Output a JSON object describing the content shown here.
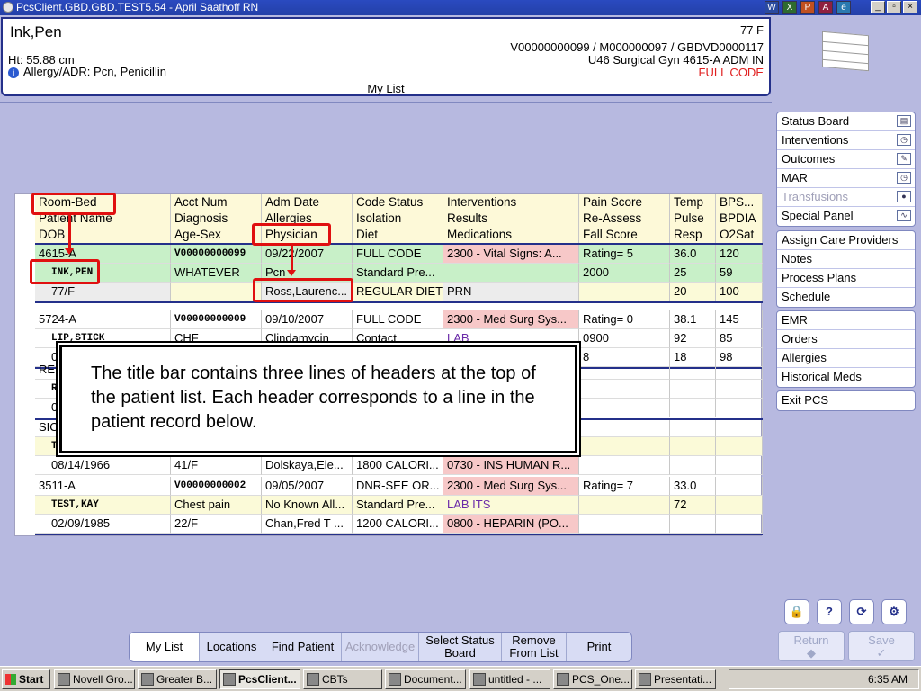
{
  "window": {
    "title": "PcsClient.GBD.GBD.TEST5.54 - April Saathoff RN",
    "toolbar_icons": [
      "W",
      "X",
      "P",
      "A",
      "e"
    ],
    "controls": [
      "_",
      "▫",
      "×"
    ]
  },
  "patient_header": {
    "name": "Ink,Pen",
    "age_sex": "77 F",
    "height": "Ht: 55.88 cm",
    "allergy": "Allergy/ADR: Pcn, Penicillin",
    "ids": "V00000000099 / M000000097 / GBDVD0000117",
    "location": "U46 Surgical Gyn  4615-A  ADM IN",
    "code_status": "FULL CODE",
    "list_name": "My List"
  },
  "grid": {
    "headers": [
      [
        "Room-Bed",
        "Acct Num",
        "Adm Date",
        "Code Status",
        "Interventions",
        "Pain Score",
        "Temp",
        "BPS..."
      ],
      [
        "Patient Name",
        "Diagnosis",
        "Allergies",
        "Isolation",
        "Results",
        "Re-Assess",
        "Pulse",
        "BPDIA"
      ],
      [
        "DOB",
        "Age-Sex",
        "Physician",
        "Diet",
        "Medications",
        "Fall Score",
        "Resp",
        "O2Sat"
      ]
    ],
    "patients": [
      {
        "rows": [
          [
            "4615-A",
            "V00000000099",
            "09/22/2007",
            "FULL CODE",
            "2300 - Vital Signs: A...",
            "Rating= 5",
            "36.0",
            "120"
          ],
          [
            "INK,PEN",
            "WHATEVER",
            "Pcn",
            "Standard Pre...",
            "",
            "2000",
            "25",
            "59"
          ],
          [
            "77/F",
            "",
            "Ross,Laurenc...",
            "REGULAR DIET",
            "PRN",
            "",
            "20",
            "100"
          ]
        ]
      },
      {
        "rows": [
          [
            "5724-A",
            "V00000000009",
            "09/10/2007",
            "FULL CODE",
            "2300 - Med Surg Sys...",
            "Rating= 0",
            "38.1",
            "145"
          ],
          [
            "LIP,STICK",
            "CHF",
            "Clindamycin",
            "Contact",
            "LAB",
            "0900",
            "92",
            "85"
          ],
          [
            "04/",
            "",
            "",
            "",
            "",
            "8",
            "18",
            "98"
          ]
        ]
      },
      {
        "rows": [
          [
            "RED",
            "",
            "",
            "",
            "",
            "",
            "",
            ""
          ],
          [
            "RE",
            "",
            "",
            "",
            "",
            "",
            "",
            ""
          ],
          [
            "0",
            "",
            "",
            "",
            "",
            "",
            "",
            ""
          ]
        ]
      },
      {
        "rows": [
          [
            "SIC",
            "",
            "",
            "",
            "",
            "",
            "",
            ""
          ],
          [
            "TE",
            "",
            "",
            "",
            "",
            "",
            "",
            ""
          ],
          [
            "08/14/1966",
            "41/F",
            "Dolskaya,Ele...",
            "1800 CALORI...",
            "0730 - INS HUMAN R...",
            "",
            "",
            ""
          ]
        ]
      },
      {
        "rows": [
          [
            "3511-A",
            "V00000000002",
            "09/05/2007",
            "DNR-SEE OR...",
            "2300 - Med Surg Sys...",
            "Rating= 7",
            "33.0",
            ""
          ],
          [
            "TEST,KAY",
            "Chest pain",
            "No Known All...",
            "Standard Pre...",
            "LAB ITS",
            "",
            "72",
            ""
          ],
          [
            "02/09/1985",
            "22/F",
            "Chan,Fred T ...",
            "1200 CALORI...",
            "0800 - HEPARIN (PO...",
            "",
            "",
            ""
          ]
        ]
      }
    ]
  },
  "callout": {
    "text": "The title bar contains three lines of headers at the top of the patient list. Each header corresponds to a line in the patient record below."
  },
  "side_panel": {
    "group1": [
      {
        "label": "Status Board",
        "icon": "book-icon"
      },
      {
        "label": "Interventions",
        "icon": "clock-icon"
      },
      {
        "label": "Outcomes",
        "icon": "pencil-icon"
      },
      {
        "label": "MAR",
        "icon": "clock-icon"
      },
      {
        "label": "Transfusions",
        "icon": "drop-icon",
        "disabled": true
      },
      {
        "label": "Special Panel",
        "icon": "pulse-icon"
      }
    ],
    "group2": [
      "Assign Care Providers",
      "Notes",
      "Process Plans",
      "Schedule"
    ],
    "group3": [
      "EMR",
      "Orders",
      "Allergies",
      "Historical Meds"
    ],
    "group4": [
      "Exit PCS"
    ],
    "return_label": "Return",
    "save_label": "Save"
  },
  "bottom_tabs": [
    {
      "label": "My List",
      "selected": true
    },
    {
      "label": "Locations"
    },
    {
      "label": "Find Patient"
    },
    {
      "label": "Acknowledge",
      "disabled": true
    },
    {
      "label": "Select Status Board"
    },
    {
      "label": "Remove From List"
    },
    {
      "label": "Print"
    }
  ],
  "taskbar": {
    "start": "Start",
    "tasks": [
      "Novell Gro...",
      "Greater B...",
      "PcsClient...",
      "CBTs",
      "Document...",
      "untitled - ...",
      "PCS_One...",
      "Presentati..."
    ],
    "clock": "6:35 AM"
  }
}
